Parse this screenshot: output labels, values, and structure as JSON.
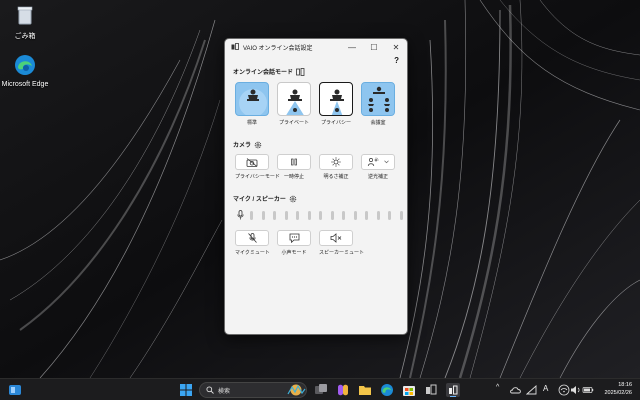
{
  "desktop": {
    "icons": [
      {
        "label": "ごみ箱",
        "icon": "recycle-bin-icon"
      },
      {
        "label": "Microsoft Edge",
        "icon": "edge-icon"
      }
    ]
  },
  "window": {
    "title": "VAIO オンライン会話設定",
    "help": "?",
    "controls": {
      "minimize": "—",
      "maximize": "☐",
      "close": "✕"
    },
    "sections": {
      "mode": "オンライン会話モード",
      "camera": "カメラ",
      "mic": "マイク / スピーカー"
    },
    "modes": [
      {
        "label": "標準",
        "state": "active"
      },
      {
        "label": "プライベート",
        "state": "normal"
      },
      {
        "label": "プライバシー",
        "state": "selected"
      },
      {
        "label": "会議室",
        "state": "normal"
      }
    ],
    "camera_buttons": [
      {
        "label": "プライバシーモード",
        "icon": "camera-off-icon"
      },
      {
        "label": "一時停止",
        "icon": "pause-icon"
      },
      {
        "label": "明るさ補正",
        "icon": "brightness-icon"
      },
      {
        "label": "逆光補正",
        "icon": "backlight-icon"
      }
    ],
    "mic_buttons": [
      {
        "label": "マイクミュート",
        "icon": "mic-off-icon"
      },
      {
        "label": "小声モード",
        "icon": "whisper-icon"
      },
      {
        "label": "スピーカーミュート",
        "icon": "speaker-mute-icon"
      }
    ],
    "mic_level_bars": 14
  },
  "taskbar": {
    "search_placeholder": "検索",
    "tray_ime": "A",
    "time": "18:16",
    "date": "2025/02/26"
  },
  "colors": {
    "accent": "#8ec5ef",
    "accent_dark": "#2f6db3",
    "taskbar": "#1c1c1e"
  }
}
